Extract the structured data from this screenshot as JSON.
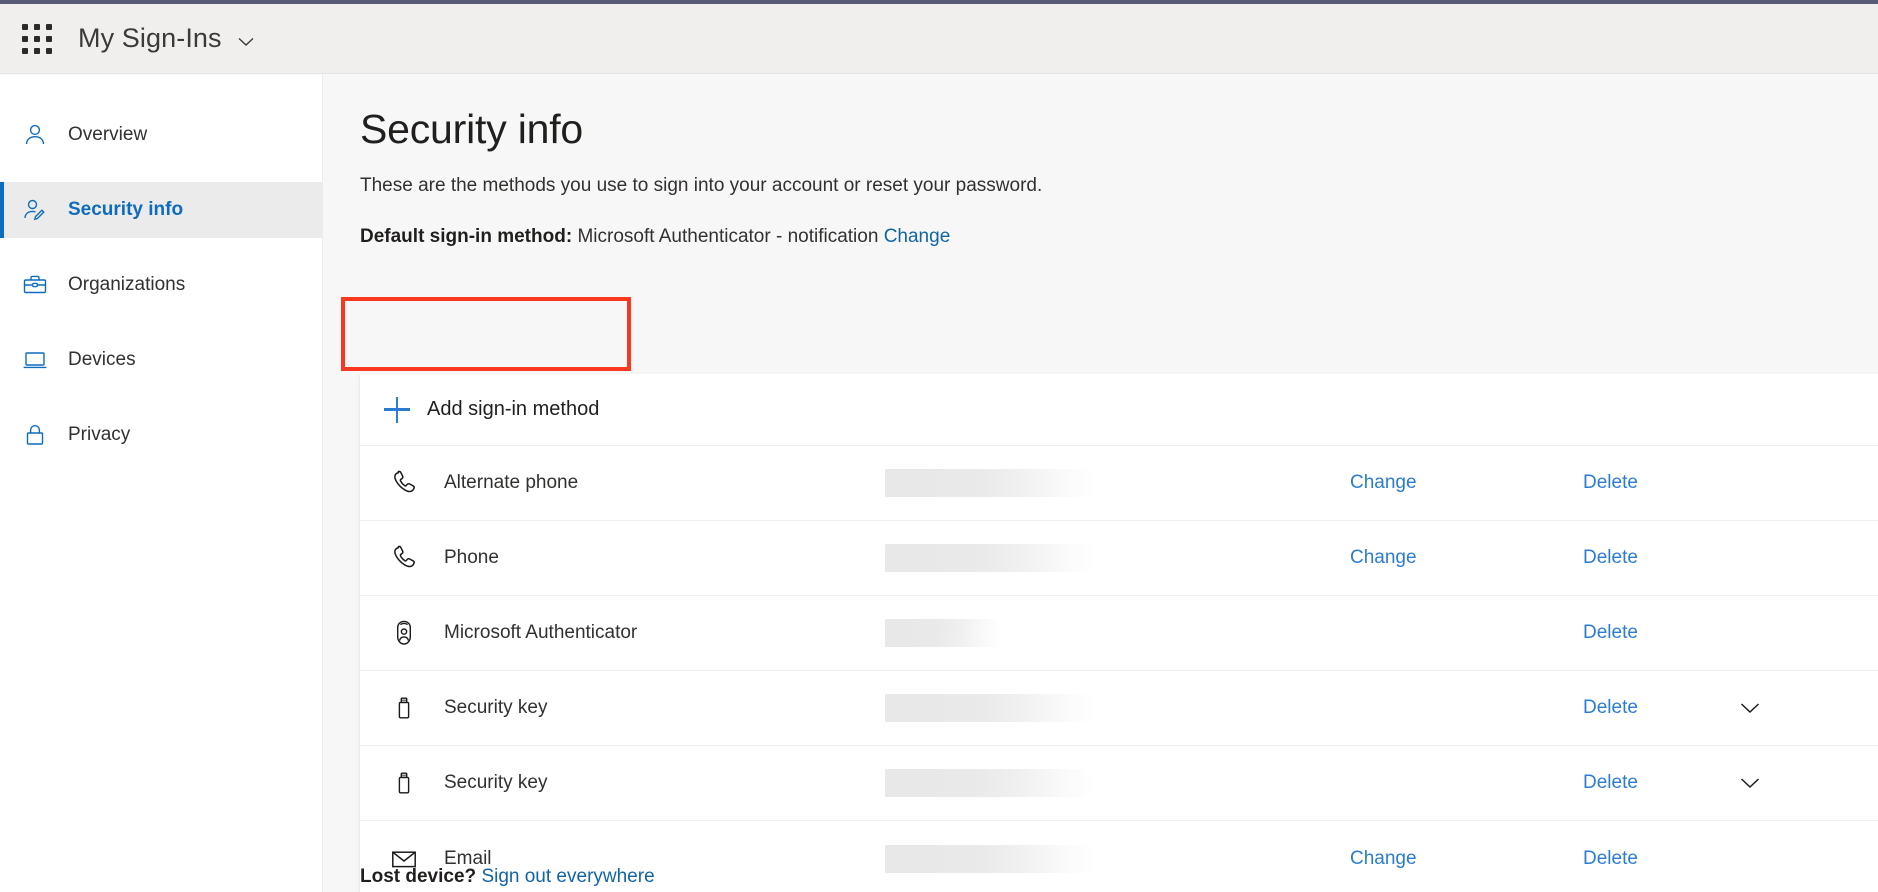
{
  "header": {
    "app_title": "My Sign-Ins",
    "waffle_icon": "waffle-grid-icon",
    "chevron_icon": "chevron-down-icon",
    "accent_color": "#585a78"
  },
  "sidebar": {
    "items": [
      {
        "label": "Overview",
        "icon": "person-icon",
        "active": false
      },
      {
        "label": "Security info",
        "icon": "person-edit-icon",
        "active": true
      },
      {
        "label": "Organizations",
        "icon": "briefcase-icon",
        "active": false
      },
      {
        "label": "Devices",
        "icon": "laptop-icon",
        "active": false
      },
      {
        "label": "Privacy",
        "icon": "lock-icon",
        "active": false
      }
    ],
    "active_color": "#0f6cbd"
  },
  "main": {
    "page_title": "Security info",
    "description": "These are the methods you use to sign into your account or reset your password.",
    "default_method": {
      "label": "Default sign-in method:",
      "value": "Microsoft Authenticator - notification",
      "change_link": "Change"
    },
    "add_button": {
      "label": "Add sign-in method",
      "icon": "plus-icon"
    },
    "methods": [
      {
        "name": "Alternate phone",
        "icon": "phone-icon",
        "value": "",
        "value_width": 210,
        "change": "Change",
        "delete": "Delete",
        "expand": false
      },
      {
        "name": "Phone",
        "icon": "phone-icon",
        "value": "",
        "value_width": 210,
        "change": "Change",
        "delete": "Delete",
        "expand": false
      },
      {
        "name": "Microsoft Authenticator",
        "icon": "authenticator-icon",
        "value": "",
        "value_width": 118,
        "change": "",
        "delete": "Delete",
        "expand": false
      },
      {
        "name": "Security key",
        "icon": "usb-key-icon",
        "value": "",
        "value_width": 210,
        "change": "",
        "delete": "Delete",
        "expand": true
      },
      {
        "name": "Security key",
        "icon": "usb-key-icon",
        "value": "",
        "value_width": 210,
        "change": "",
        "delete": "Delete",
        "expand": true
      },
      {
        "name": "Email",
        "icon": "envelope-icon",
        "value": "",
        "value_width": 210,
        "change": "Change",
        "delete": "Delete",
        "expand": false
      }
    ],
    "footer": {
      "lost_device_label": "Lost device?",
      "sign_out_link": "Sign out everywhere"
    }
  },
  "annotation": {
    "target": "add-sign-in-method-button",
    "color": "#f93822"
  },
  "colors": {
    "link": "#2b7cd3",
    "accent": "#0f6cbd",
    "header_bg": "#f0efee",
    "page_bg": "#f7f7f7",
    "card_bg": "#ffffff"
  }
}
